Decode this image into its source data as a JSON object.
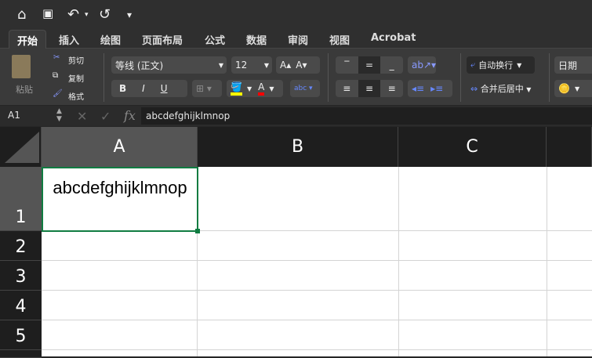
{
  "quick_access": {
    "home": "⌂",
    "save": "💾",
    "undo": "↶",
    "redo": "↺",
    "more": "▾"
  },
  "tabs": [
    "开始",
    "插入",
    "绘图",
    "页面布局",
    "公式",
    "数据",
    "审阅",
    "视图",
    "Acrobat"
  ],
  "ribbon": {
    "paste": "粘贴",
    "cut": "剪切",
    "copy": "复制",
    "format_painter": "格式",
    "font_name": "等线 (正文)",
    "font_size": "12",
    "bold": "B",
    "italic": "I",
    "underline": "U",
    "wrap_text": "自动换行",
    "merge_center": "合并后居中",
    "number_format": "日期",
    "highlight_color": "#ffff00",
    "font_color": "#ff0000"
  },
  "formula_bar": {
    "name_box": "A1",
    "fx": "fx",
    "value": "abcdefghijklmnop"
  },
  "sheet": {
    "columns": [
      "A",
      "B",
      "C"
    ],
    "rows": [
      "1",
      "2",
      "3",
      "4",
      "5"
    ],
    "selected_cell": "A1",
    "cell_a1": "abcdefghijklmnop",
    "selection_color": "#107c41"
  }
}
